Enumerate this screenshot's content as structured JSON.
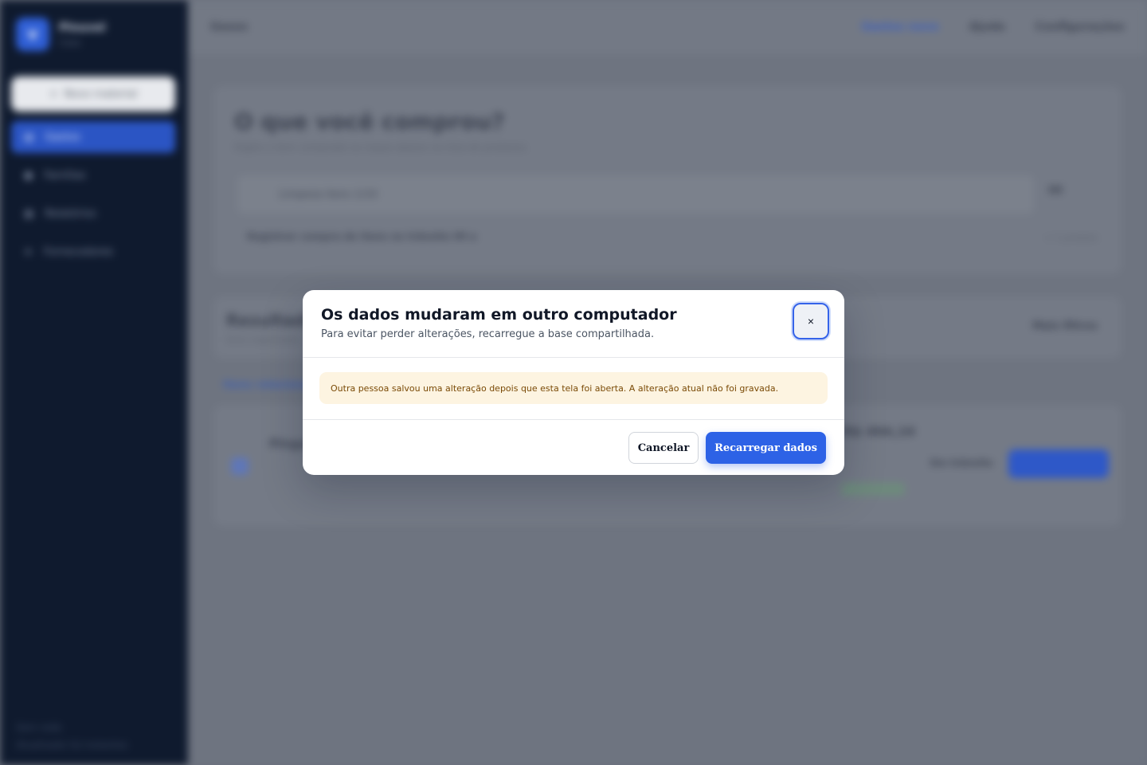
{
  "app": {
    "brand_name": "Pinuvel",
    "brand_sub": "Casa",
    "brand_logo": "V"
  },
  "sidebar": {
    "new_button": "Novo material",
    "items": [
      {
        "label": "Gastos",
        "icon": "receipt-icon"
      },
      {
        "label": "Famílias",
        "icon": "pin-icon"
      },
      {
        "label": "Relatórios",
        "icon": "chart-icon"
      },
      {
        "label": "Fornecedores",
        "icon": "list-icon"
      }
    ],
    "footer_line1": "Sem rede",
    "footer_line2": "Atualizado há instantes"
  },
  "topbar": {
    "crumb": "Gasos",
    "link": "Gastos novo",
    "menu1": "Ajuda",
    "menu2": "Configurações"
  },
  "main": {
    "card1_title": "O que você comprou?",
    "card1_sub": "Digite o item comprado ou toque abaixo na lista de produtos.",
    "card1_field": "Limpeza itens 1/10",
    "card1_qty": "00",
    "card1_hint": "Registrar compra de itens no trânsito IM a",
    "card1_hint2": "+ 1 produto",
    "card2_title": "Resultados",
    "card2_sub": "Itens registrados",
    "card2_right": "Mais filtros",
    "section_label": "Itens relacionados",
    "card3_product": "Pinguim",
    "card3_price": "R$ 494,10",
    "card3_status": "Em trânsito"
  },
  "dialog": {
    "title": "Os dados mudaram em outro computador",
    "subtitle": "Para evitar perder alterações, recarregue a base compartilhada.",
    "close_label": "×",
    "alert": "Outra pessoa salvou uma alteração depois que esta tela foi aberta. A alteração atual não foi gravada.",
    "cancel_label": "Cancelar",
    "reload_label": "Recarregar dados"
  },
  "colors": {
    "primary": "#2d62e6",
    "alert_bg": "#fdf4e1",
    "alert_text": "#7a4a06",
    "sidebar_bg": "#0f1a2e"
  }
}
